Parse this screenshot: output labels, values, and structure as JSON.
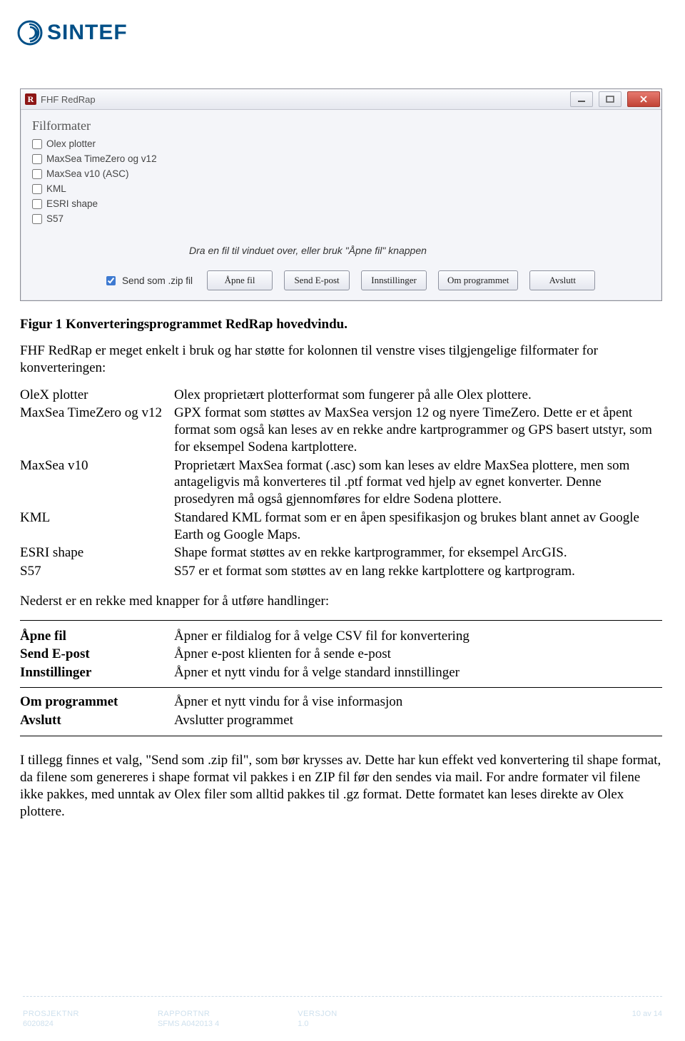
{
  "brand": {
    "name": "SINTEF"
  },
  "window": {
    "title": "FHF RedRap",
    "section_title": "Filformater",
    "formats": [
      "Olex plotter",
      "MaxSea TimeZero og v12",
      "MaxSea v10 (ASC)",
      "KML",
      "ESRI shape",
      "S57"
    ],
    "hint": "Dra en fil til vinduet over, eller bruk \"Åpne fil\" knappen",
    "send_zip_label": "Send som .zip fil",
    "buttons": {
      "open": "Åpne fil",
      "send": "Send E-post",
      "settings": "Innstillinger",
      "about": "Om programmet",
      "exit": "Avslutt"
    }
  },
  "doc": {
    "fig_caption": "Figur 1 Konverteringsprogrammet RedRap hovedvindu.",
    "intro": "FHF RedRap er meget enkelt i bruk og har støtte for kolonnen til venstre vises tilgjengelige filformater for konverteringen:",
    "formats": [
      {
        "name": "OleX plotter",
        "desc": "Olex proprietært plotterformat som fungerer på alle Olex plottere."
      },
      {
        "name": "MaxSea TimeZero og v12",
        "desc": "GPX format som støttes av MaxSea versjon 12 og nyere TimeZero. Dette er et åpent format som også kan leses av en rekke andre kartprogrammer og GPS basert utstyr, som for eksempel Sodena kartplottere."
      },
      {
        "name": "MaxSea v10",
        "desc": "Proprietært MaxSea format (.asc) som kan leses av eldre MaxSea plottere, men som antageligvis må konverteres til .ptf format ved hjelp av egnet konverter. Denne prosedyren må også gjennomføres for eldre Sodena plottere."
      },
      {
        "name": "KML",
        "desc": "Standared KML format som er en åpen spesifikasjon og brukes blant annet av Google Earth og Google Maps."
      },
      {
        "name": "ESRI shape",
        "desc": "Shape format støttes av en rekke kartprogrammer, for eksempel ArcGIS."
      },
      {
        "name": "S57",
        "desc": "S57 er et format som støttes av en lang rekke kartplottere og kartprogram."
      }
    ],
    "actions_intro": "Nederst er en rekke med knapper for å utføre handlinger:",
    "actions1": [
      {
        "name": "Åpne fil",
        "desc": "Åpner er fildialog for å velge CSV fil for konvertering"
      },
      {
        "name": "Send E-post",
        "desc": "Åpner e-post klienten for å sende e-post"
      },
      {
        "name": "Innstillinger",
        "desc": "Åpner et nytt vindu for å velge standard innstillinger"
      }
    ],
    "actions2": [
      {
        "name": "Om programmet",
        "desc": "Åpner et nytt vindu for å vise informasjon"
      },
      {
        "name": "Avslutt",
        "desc": "Avslutter programmet"
      }
    ],
    "outro": "I tillegg finnes et valg, \"Send som .zip fil\", som bør krysses av. Dette har kun effekt ved konvertering til shape format, da filene som genereres i shape format vil pakkes i en ZIP fil før den sendes via mail. For andre formater vil filene ikke pakkes, med unntak av Olex filer som alltid pakkes til .gz format. Dette formatet kan leses direkte av Olex plottere."
  },
  "footer": {
    "col1_label": "PROSJEKTNR",
    "col1_val": "6020824",
    "col2_label": "RAPPORTNR",
    "col2_val": "SFMS A042013 4",
    "col3_label": "VERSJON",
    "col3_val": "1.0",
    "page": "10 av 14"
  }
}
